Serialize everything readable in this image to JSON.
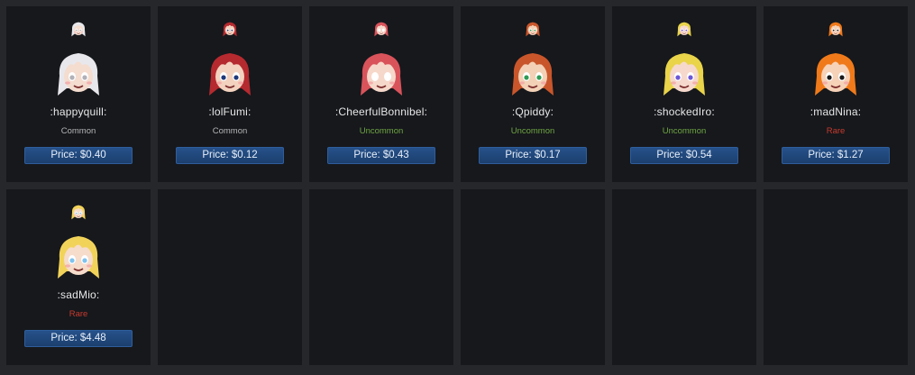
{
  "emotes": [
    {
      "name": ":happyquill:",
      "rarity": "Common",
      "price": "Price: $0.40",
      "avatar": "white-haired-girl-emote",
      "colors": {
        "hair": "#e8e8ec",
        "skin": "#f4dccf",
        "accent": "#b0b0b8"
      }
    },
    {
      "name": ":lolFumi:",
      "rarity": "Common",
      "price": "Price: $0.12",
      "avatar": "red-haired-laughing-girl-emote",
      "colors": {
        "hair": "#b52a2f",
        "skin": "#f3d2bf",
        "accent": "#1f3a7a"
      }
    },
    {
      "name": ":CheerfulBonnibel:",
      "rarity": "Uncommon",
      "price": "Price: $0.43",
      "avatar": "pink-haired-girl-emote",
      "colors": {
        "hair": "#d9535b",
        "skin": "#f6d8ca",
        "accent": "#ffffff"
      }
    },
    {
      "name": ":Qpiddy:",
      "rarity": "Uncommon",
      "price": "Price: $0.17",
      "avatar": "crowned-girl-heart-emote",
      "colors": {
        "hair": "#c9562b",
        "skin": "#f3d1b6",
        "accent": "#2e9b55"
      }
    },
    {
      "name": ":shockedIro:",
      "rarity": "Uncommon",
      "price": "Price: $0.54",
      "avatar": "rainbow-haired-shocked-girl-emote",
      "colors": {
        "hair": "#e9d44a",
        "skin": "#f6d9cc",
        "accent": "#6b57d8"
      }
    },
    {
      "name": ":madNina:",
      "rarity": "Rare",
      "price": "Price: $1.27",
      "avatar": "orange-haired-angry-girl-emote",
      "colors": {
        "hair": "#f07a1a",
        "skin": "#f6d2b8",
        "accent": "#1a1a1a"
      }
    },
    {
      "name": ":sadMio:",
      "rarity": "Rare",
      "price": "Price: $4.48",
      "avatar": "blonde-crying-girl-emote",
      "colors": {
        "hair": "#f2d35a",
        "skin": "#f6dccb",
        "accent": "#7fc3ef"
      }
    }
  ],
  "rarity_colors": {
    "Common": "#b5b5b5",
    "Uncommon": "#6fa542",
    "Rare": "#c93a2e"
  },
  "theme": {
    "page_bg": "#25272b",
    "card_bg": "#16181c",
    "button_bg": "#214779"
  }
}
